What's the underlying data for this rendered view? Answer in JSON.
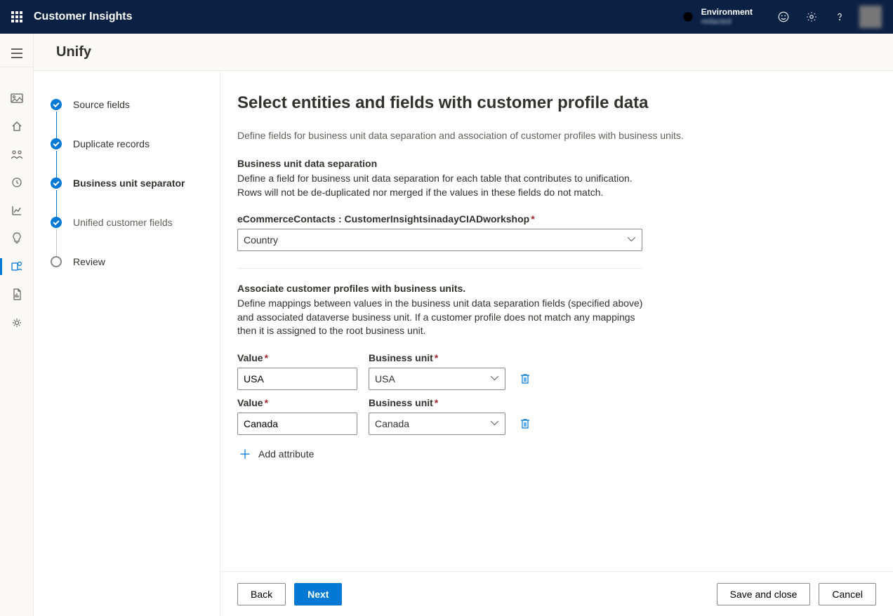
{
  "app_title": "Customer Insights",
  "environment": {
    "label": "Environment",
    "name": "redacted"
  },
  "page": {
    "title": "Unify"
  },
  "steps": [
    {
      "label": "Source fields",
      "state": "done"
    },
    {
      "label": "Duplicate records",
      "state": "done"
    },
    {
      "label": "Business unit separator",
      "state": "done",
      "current": true
    },
    {
      "label": "Unified customer fields",
      "state": "done"
    },
    {
      "label": "Review",
      "state": "pending"
    }
  ],
  "form": {
    "heading": "Select entities and fields with customer profile data",
    "description": "Define fields for business unit data separation and association of customer profiles with business units.",
    "section1": {
      "title": "Business unit data separation",
      "text": "Define a field for business unit data separation for each table that contributes to unification. Rows will not be de-duplicated nor merged if the values in these fields do not match.",
      "field_label": "eCommerceContacts : CustomerInsightsinadayCIADworkshop",
      "field_value": "Country"
    },
    "section2": {
      "title": "Associate customer profiles with business units.",
      "text": "Define mappings between values in the business unit data separation fields (specified above) and associated dataverse business unit. If a customer profile does not match any mappings then it is assigned to the root business unit.",
      "value_label": "Value",
      "bu_label": "Business unit",
      "rows": [
        {
          "value": "USA",
          "business_unit": "USA"
        },
        {
          "value": "Canada",
          "business_unit": "Canada"
        }
      ],
      "add_label": "Add attribute"
    }
  },
  "footer": {
    "back": "Back",
    "next": "Next",
    "save_close": "Save and close",
    "cancel": "Cancel"
  }
}
